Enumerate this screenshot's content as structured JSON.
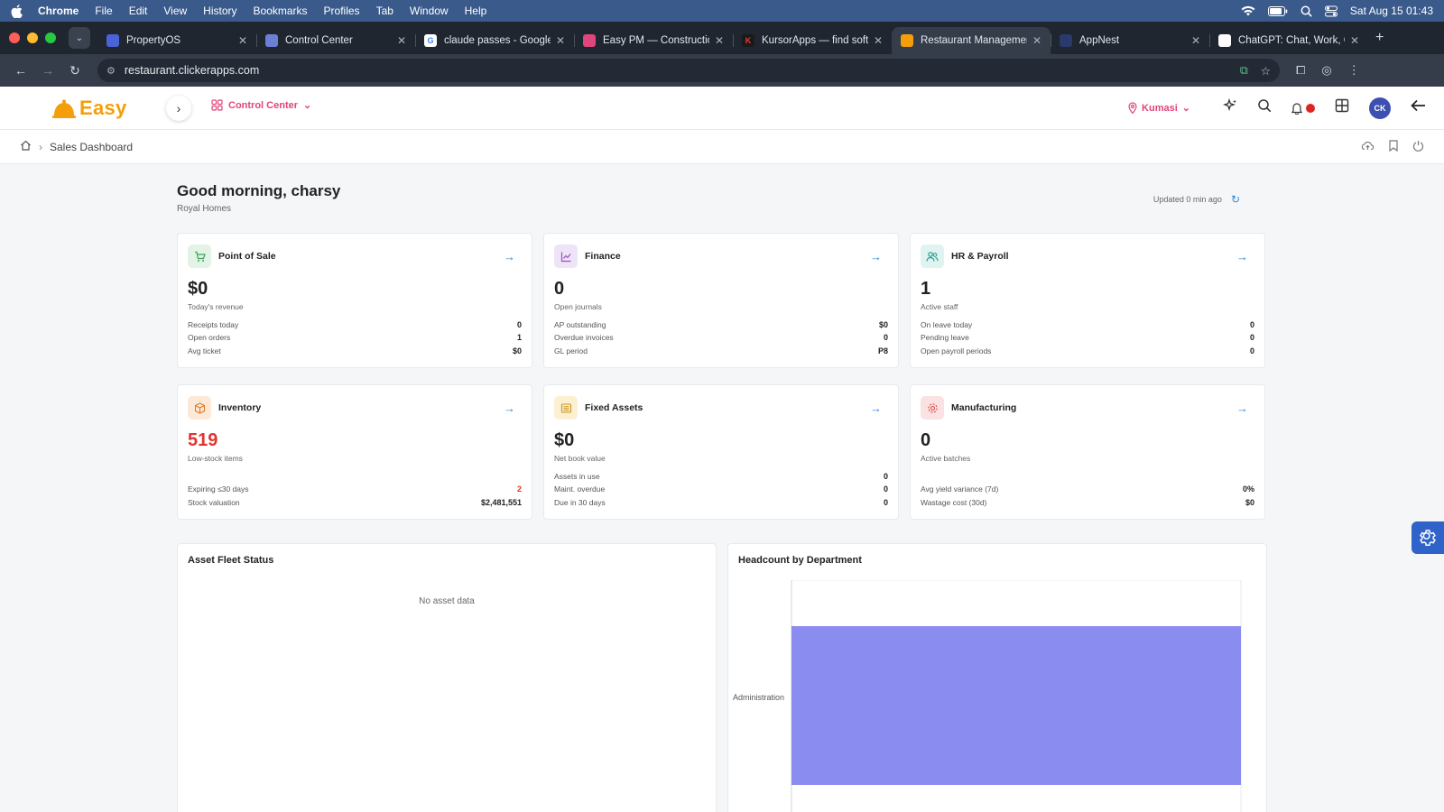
{
  "menubar": {
    "app": "Chrome",
    "items": [
      "File",
      "Edit",
      "View",
      "History",
      "Bookmarks",
      "Profiles",
      "Tab",
      "Window",
      "Help"
    ],
    "clock": "Sat Aug 15  01:43"
  },
  "tabs": [
    {
      "title": "PropertyOS",
      "color": "#4a63d8",
      "glyph": ""
    },
    {
      "title": "Control Center",
      "color": "#6b7fd6",
      "glyph": ""
    },
    {
      "title": "claude passes - Google S",
      "color": "#ffffff",
      "glyph": "G"
    },
    {
      "title": "Easy PM — Construction",
      "color": "#e0457b",
      "glyph": ""
    },
    {
      "title": "KursorApps — find softw",
      "color": "#1a1a1a",
      "glyph": "K"
    },
    {
      "title": "Restaurant Management",
      "color": "#f59e0b",
      "glyph": "",
      "active": true
    },
    {
      "title": "AppNest",
      "color": "#2a3a6a",
      "glyph": ""
    },
    {
      "title": "ChatGPT: Chat, Work, Cr",
      "color": "#ffffff",
      "glyph": ""
    }
  ],
  "url": "restaurant.clickerapps.com",
  "app": {
    "logo_text": "Easy",
    "module": "Control Center",
    "location": "Kumasi",
    "avatar_initials": "CK",
    "breadcrumb": "Sales Dashboard"
  },
  "greeting": {
    "title": "Good morning, charsy",
    "company": "Royal Homes",
    "updated": "Updated 0 min ago"
  },
  "cards": [
    {
      "title": "Point of Sale",
      "icon": "cart-icon",
      "icon_bg": "#e3f3e6",
      "icon_color": "#3fa55b",
      "value": "$0",
      "caption": "Today's revenue",
      "metrics": [
        {
          "label": "Receipts today",
          "value": "0"
        },
        {
          "label": "Open orders",
          "value": "1"
        },
        {
          "label": "Avg ticket",
          "value": "$0"
        }
      ]
    },
    {
      "title": "Finance",
      "icon": "chart-icon",
      "icon_bg": "#efe3f7",
      "icon_color": "#9b4fc4",
      "value": "0",
      "caption": "Open journals",
      "metrics": [
        {
          "label": "AP outstanding",
          "value": "$0"
        },
        {
          "label": "Overdue invoices",
          "value": "0"
        },
        {
          "label": "GL period",
          "value": "P8"
        }
      ]
    },
    {
      "title": "HR & Payroll",
      "icon": "people-icon",
      "icon_bg": "#dff3f1",
      "icon_color": "#2a9d8f",
      "value": "1",
      "caption": "Active staff",
      "metrics": [
        {
          "label": "On leave today",
          "value": "0"
        },
        {
          "label": "Pending leave",
          "value": "0"
        },
        {
          "label": "Open payroll periods",
          "value": "0"
        }
      ]
    },
    {
      "title": "Inventory",
      "icon": "box-icon",
      "icon_bg": "#fde9d8",
      "icon_color": "#e07b2a",
      "value": "519",
      "value_red": true,
      "caption": "Low-stock items",
      "metrics": [
        {
          "label": "Expiring ≤30 days",
          "value": "2",
          "red": true
        },
        {
          "label": "Stock valuation",
          "value": "$2,481,551"
        }
      ]
    },
    {
      "title": "Fixed Assets",
      "icon": "list-icon",
      "icon_bg": "#fdf0d2",
      "icon_color": "#c8961e",
      "value": "$0",
      "caption": "Net book value",
      "metrics": [
        {
          "label": "Assets in use",
          "value": "0"
        },
        {
          "label": "Maint. overdue",
          "value": "0"
        },
        {
          "label": "Due in 30 days",
          "value": "0"
        }
      ]
    },
    {
      "title": "Manufacturing",
      "icon": "cog-icon",
      "icon_bg": "#fbe2e2",
      "icon_color": "#d94848",
      "value": "0",
      "caption": "Active batches",
      "metrics": [
        {
          "label": "Avg yield variance (7d)",
          "value": "0%"
        },
        {
          "label": "Wastage cost (30d)",
          "value": "$0"
        }
      ]
    }
  ],
  "panels": {
    "asset_title": "Asset Fleet Status",
    "asset_empty": "No asset data",
    "headcount_title": "Headcount by Department"
  },
  "chart_data": {
    "type": "bar",
    "orientation": "horizontal",
    "title": "Headcount by Department",
    "categories": [
      "Administration"
    ],
    "values": [
      1
    ],
    "bar_color": "#8b8cf0",
    "grid": true
  }
}
